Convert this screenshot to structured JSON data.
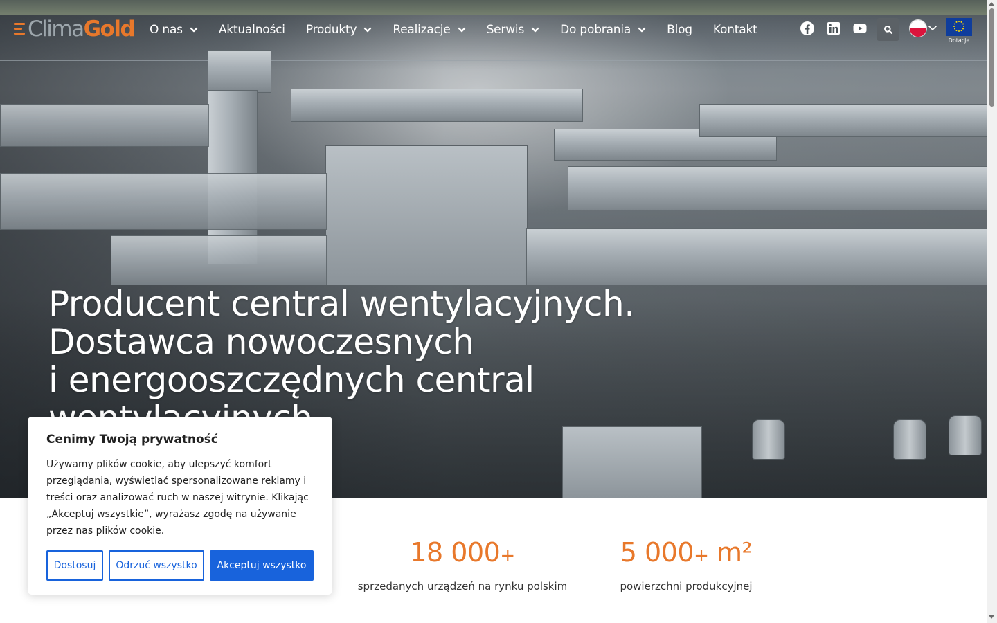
{
  "brand": {
    "logo_clima": "Clima",
    "logo_gold": "Gold",
    "accent": "#e8782b"
  },
  "nav": {
    "items": [
      {
        "label": "O nas",
        "dropdown": true
      },
      {
        "label": "Aktualności",
        "dropdown": false
      },
      {
        "label": "Produkty",
        "dropdown": true
      },
      {
        "label": "Realizacje",
        "dropdown": true
      },
      {
        "label": "Serwis",
        "dropdown": true
      },
      {
        "label": "Do pobrania",
        "dropdown": true
      },
      {
        "label": "Blog",
        "dropdown": false
      },
      {
        "label": "Kontakt",
        "dropdown": false
      }
    ],
    "social_icons": [
      "facebook-icon",
      "linkedin-icon",
      "youtube-icon"
    ],
    "search_icon": "search-icon",
    "language": "pl",
    "eu_label": "Dotacje"
  },
  "hero": {
    "lines": [
      "Producent central wentylacyjnych.",
      "Dostawca nowoczesnych",
      "i energooszczędnych central",
      "wentylacyjnych."
    ]
  },
  "stats": [
    {
      "value": "18 000",
      "suffix": "+",
      "unit": "",
      "label": "sprzedanych urządzeń na rynku polskim"
    },
    {
      "value": "5 000",
      "suffix": "+",
      "unit": " m²",
      "label": "powierzchni produkcyjnej"
    }
  ],
  "cookie": {
    "title": "Cenimy Twoją prywatność",
    "text": "Używamy plików cookie, aby ulepszyć komfort przeglądania, wyświetlać spersonalizowane reklamy i treści oraz analizować ruch w naszej witrynie. Klikając „Akceptuj wszystkie”, wyrażasz zgodę na używanie przez nas plików cookie.",
    "btn_customize": "Dostosuj",
    "btn_reject": "Odrzuć wszystko",
    "btn_accept": "Akceptuj wszystko",
    "button_color": "#1863dc"
  }
}
